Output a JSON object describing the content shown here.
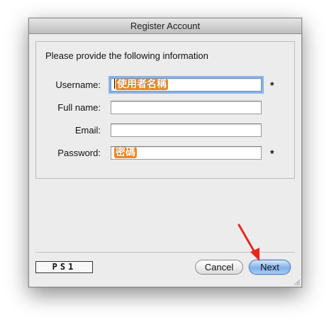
{
  "window": {
    "title": "Register Account"
  },
  "form": {
    "instruction": "Please provide the following information",
    "fields": [
      {
        "label": "Username:",
        "value": "使用者名稱",
        "required_mark": "*"
      },
      {
        "label": "Full name:",
        "value": ""
      },
      {
        "label": "Email:",
        "value": ""
      },
      {
        "label": "Password:",
        "value": "密碼",
        "required_mark": "*"
      }
    ]
  },
  "footer": {
    "logo_text": "PS1",
    "cancel_label": "Cancel",
    "next_label": "Next"
  },
  "annotation": {
    "arrow_color": "#e8281e",
    "arrow_target": "Next"
  }
}
